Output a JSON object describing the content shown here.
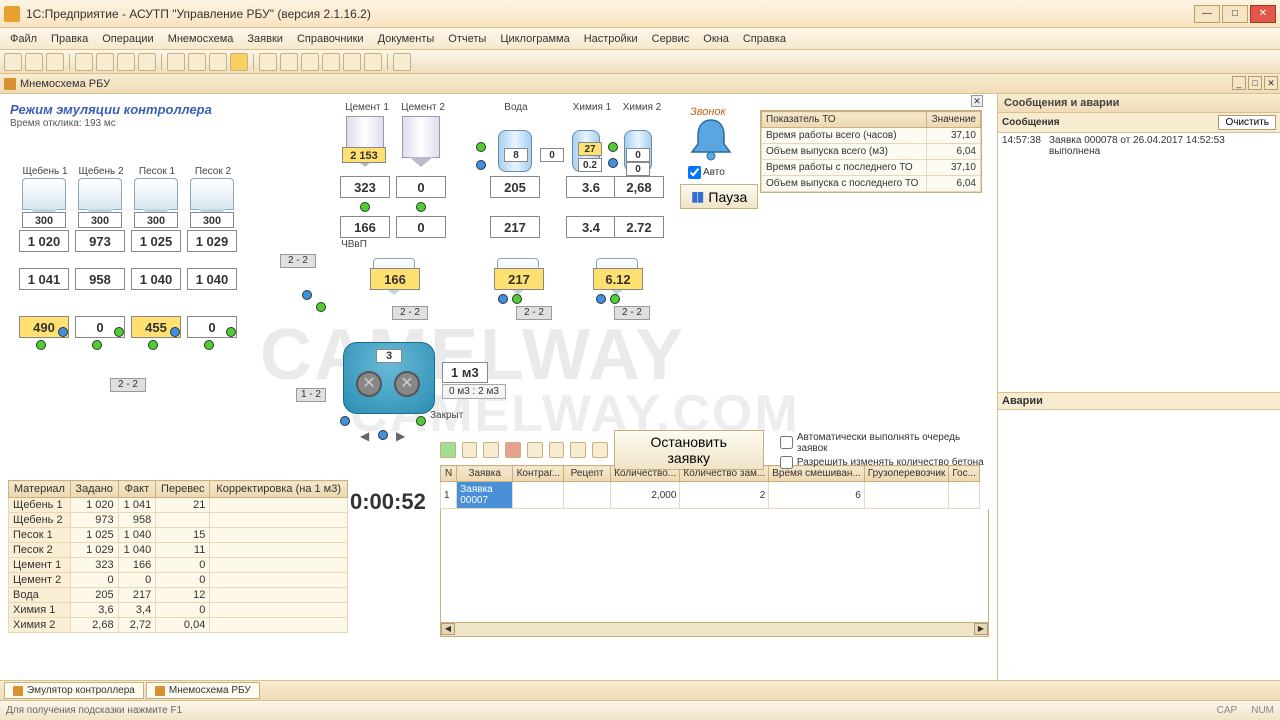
{
  "app": {
    "title": "1С:Предприятие - АСУТП \"Управление РБУ\" (версия 2.1.16.2)",
    "doc_title": "Мнемосхема РБУ"
  },
  "menu": [
    "Файл",
    "Правка",
    "Операции",
    "Мнемосхема",
    "Заявки",
    "Справочники",
    "Документы",
    "Отчеты",
    "Циклограмма",
    "Настройки",
    "Сервис",
    "Окна",
    "Справка"
  ],
  "mode": {
    "title": "Режим эмуляции контроллера",
    "response": "Время отклика: 193 мс"
  },
  "alarm": {
    "label": "Звонок",
    "auto": "Авто",
    "pause": "Пауза"
  },
  "silos": {
    "sh1": {
      "label": "Щебень 1",
      "v1": "300",
      "v2": "1 020",
      "v3": "1 041",
      "v4": "490"
    },
    "sh2": {
      "label": "Щебень 2",
      "v1": "300",
      "v2": "973",
      "v3": "958",
      "v4": "0"
    },
    "p1": {
      "label": "Песок 1",
      "v1": "300",
      "v2": "1 025",
      "v3": "1 040",
      "v4": "455"
    },
    "p2": {
      "label": "Песок 2",
      "v1": "300",
      "v2": "1 029",
      "v3": "1 040",
      "v4": "0"
    },
    "c1": {
      "label": "Цемент 1",
      "target": "2 153",
      "set": "323",
      "meas": "166",
      "hopper": "166",
      "stage": "2 - 2"
    },
    "c2": {
      "label": "Цемент 2",
      "set": "0",
      "meas": "0"
    },
    "w": {
      "label": "Вода",
      "t1": "8",
      "t2": "0",
      "set": "205",
      "meas": "217",
      "hopper": "217",
      "stage": "2 - 2"
    },
    "h1": {
      "label": "Химия 1",
      "t1": "27",
      "t2": "0.2",
      "set": "3.6",
      "meas": "3.4"
    },
    "h2": {
      "label": "Химия 2",
      "t1": "0",
      "t2": "0",
      "set": "2,68",
      "meas": "2.72",
      "hopper": "6.12",
      "stage": "2 - 2"
    },
    "chvvp": "ЧВвП",
    "agg_stage_main": "2 - 2",
    "agg_stage_small": "2 - 2"
  },
  "mixer": {
    "count": "3",
    "vol": "1 м3",
    "sub": "0 м3 : 2 м3",
    "stage": "1 - 2",
    "state": "Закрыт"
  },
  "to": {
    "h1": "Показатель ТО",
    "h2": "Значение",
    "r1": {
      "k": "Время работы всего (часов)",
      "v": "37,10"
    },
    "r2": {
      "k": "Объем выпуска всего (м3)",
      "v": "6,04"
    },
    "r3": {
      "k": "Время работы с последнего ТО",
      "v": "37,10"
    },
    "r4": {
      "k": "Объем выпуска с последнего ТО",
      "v": "6,04"
    }
  },
  "timer": "0:00:52",
  "materials": {
    "cols": [
      "Материал",
      "Задано",
      "Факт",
      "Перевес",
      "Корректировка (на 1 м3)"
    ],
    "rows": [
      {
        "n": "Щебень 1",
        "a": "1 020",
        "b": "1 041",
        "c": "21",
        "d": ""
      },
      {
        "n": "Щебень 2",
        "a": "973",
        "b": "958",
        "c": "",
        "d": ""
      },
      {
        "n": "Песок 1",
        "a": "1 025",
        "b": "1 040",
        "c": "15",
        "d": ""
      },
      {
        "n": "Песок 2",
        "a": "1 029",
        "b": "1 040",
        "c": "11",
        "d": ""
      },
      {
        "n": "Цемент 1",
        "a": "323",
        "b": "166",
        "c": "0",
        "d": ""
      },
      {
        "n": "Цемент 2",
        "a": "0",
        "b": "0",
        "c": "0",
        "d": ""
      },
      {
        "n": "Вода",
        "a": "205",
        "b": "217",
        "c": "12",
        "d": ""
      },
      {
        "n": "Химия 1",
        "a": "3,6",
        "b": "3,4",
        "c": "0",
        "d": ""
      },
      {
        "n": "Химия 2",
        "a": "2,68",
        "b": "2,72",
        "c": "0,04",
        "d": ""
      }
    ]
  },
  "orders": {
    "stop_btn": "Остановить заявку",
    "chk1": "Автоматически выполнять очередь заявок",
    "chk2": "Разрешить изменять количество бетона",
    "cols": [
      "N",
      "Заявка",
      "Контраг...",
      "Рецепт",
      "Количество...",
      "Количество зам...",
      "Время смешиван...",
      "Грузоперевозчик",
      "Гос..."
    ],
    "row": {
      "n": "1",
      "order": "Заявка 00007",
      "qty": "2,000",
      "qty2": "2",
      "mix": "6"
    }
  },
  "side": {
    "header": "Сообщения и аварии",
    "messages": "Сообщения",
    "clear": "Очистить",
    "msg_time": "14:57:38",
    "msg_text": "Заявка 000078 от 26.04.2017 14:52:53 выполнена",
    "alarms": "Аварии"
  },
  "tabs": {
    "t1": "Эмулятор контроллера",
    "t2": "Мнемосхема РБУ"
  },
  "status": {
    "hint": "Для получения подсказки нажмите F1",
    "cap": "CAP",
    "num": "NUM"
  }
}
